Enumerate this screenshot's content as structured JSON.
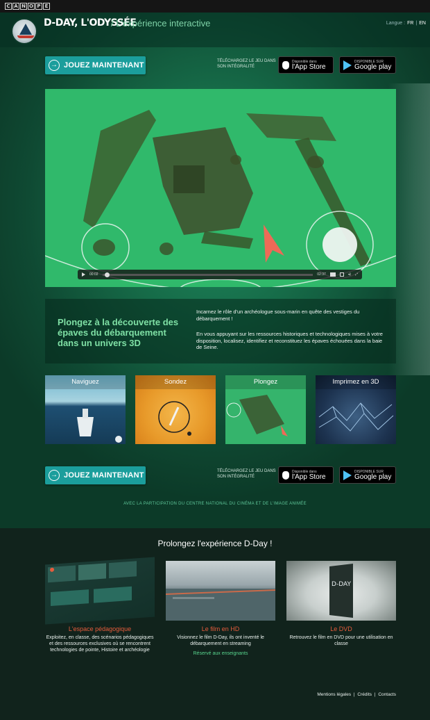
{
  "canope": {
    "letters": [
      "C",
      "A",
      "N",
      "O",
      "P",
      "É"
    ]
  },
  "header": {
    "title": "D-DAY, L'ODYSSÉE",
    "tagline": "/ L'expérience interactive",
    "lang_label": "Langue :",
    "lang_fr": "FR",
    "lang_sep": "|",
    "lang_en": "EN"
  },
  "cta": {
    "play_label": "JOUEZ MAINTENANT",
    "download_text": "TÉLÉCHARGEZ LE JEU DANS SON INTÉGRALITÉ",
    "appstore_small": "Disponible dans",
    "appstore_big": "l'App Store",
    "googleplay_small": "DISPONIBLE SUR",
    "googleplay_big": "Google play"
  },
  "video": {
    "time_current": "00:02",
    "time_total": "02:37",
    "progress": 0.01
  },
  "info": {
    "heading": "Plongez à la découverte des épaves du débarquement dans un univers 3D",
    "p1": "Incarnez le rôle d'un archéologue sous-marin en quête des vestiges du débarquement !",
    "p2": "En vous appuyant sur les ressources historiques et technologiques mises à votre disposition, localisez, identifiez et reconstituez les épaves échouées dans la baie de Seine."
  },
  "features": [
    {
      "label": "Naviguez"
    },
    {
      "label": "Sondez"
    },
    {
      "label": "Plongez"
    },
    {
      "label": "Imprimez en 3D"
    }
  ],
  "partner": "AVEC LA PARTICIPATION DU CENTRE NATIONAL DU CINÉMA ET DE L'IMAGE ANIMÉE",
  "extend": {
    "title": "Prolongez l'expérience D-Day !",
    "cards": [
      {
        "title": "L'espace pédagogique",
        "text": "Exploitez, en classe, des scénarios pédagogiques et des ressources exclusives où se rencontrent technologies de pointe, Histoire et archéologie",
        "link": ""
      },
      {
        "title": "Le film en HD",
        "text": "Visionnez le film D-Day, ils ont inventé le débarquement en streaming",
        "link": "Réservé aux enseignants"
      },
      {
        "title": "Le DVD",
        "text": "Retrouvez le film en DVD pour une utilisation en classe",
        "link": ""
      }
    ]
  },
  "footer": {
    "legal": "Mentions légales",
    "credits": "Crédits",
    "contacts": "Contacts",
    "sep": "|"
  },
  "colors": {
    "accent_teal": "#1b9e9c",
    "heading_green": "#7fe0a5",
    "card_title_red": "#e65c3c"
  }
}
